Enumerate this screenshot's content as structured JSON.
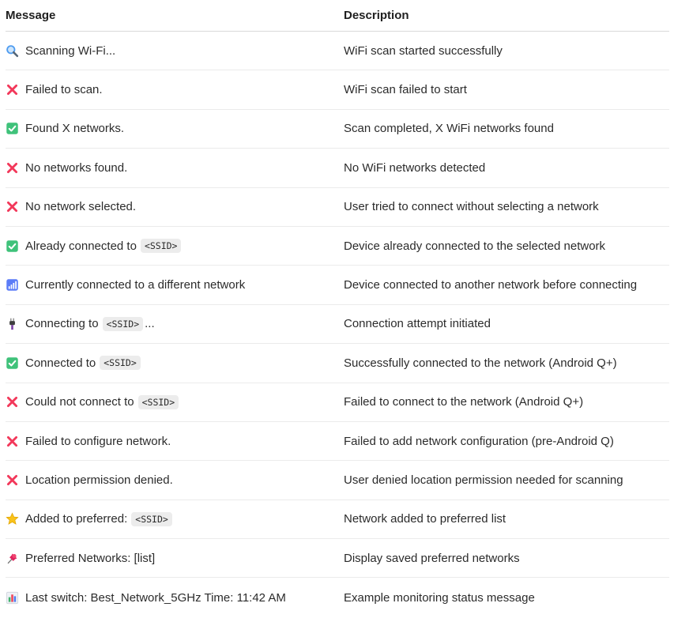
{
  "table": {
    "headers": {
      "message": "Message",
      "description": "Description"
    },
    "rows": [
      {
        "icon": "magnifier-icon",
        "message": "Scanning Wi-Fi...",
        "code": "",
        "suffix": "",
        "description": "WiFi scan started successfully"
      },
      {
        "icon": "cross-mark-icon",
        "message": "Failed to scan.",
        "code": "",
        "suffix": "",
        "description": "WiFi scan failed to start"
      },
      {
        "icon": "check-mark-icon",
        "message": "Found X networks.",
        "code": "",
        "suffix": "",
        "description": "Scan completed, X WiFi networks found"
      },
      {
        "icon": "cross-mark-icon",
        "message": "No networks found.",
        "code": "",
        "suffix": "",
        "description": "No WiFi networks detected"
      },
      {
        "icon": "cross-mark-icon",
        "message": "No network selected.",
        "code": "",
        "suffix": "",
        "description": "User tried to connect without selecting a network"
      },
      {
        "icon": "check-mark-icon",
        "message": "Already connected to",
        "code": "<SSID>",
        "suffix": "",
        "description": "Device already connected to the selected network"
      },
      {
        "icon": "signal-bars-icon",
        "message": "Currently connected to a different network",
        "code": "",
        "suffix": "",
        "description": "Device connected to another network before connecting"
      },
      {
        "icon": "plug-icon",
        "message": "Connecting to",
        "code": "<SSID>",
        "suffix": "...",
        "description": "Connection attempt initiated"
      },
      {
        "icon": "check-mark-icon",
        "message": "Connected to",
        "code": "<SSID>",
        "suffix": "",
        "description": "Successfully connected to the network (Android Q+)"
      },
      {
        "icon": "cross-mark-icon",
        "message": "Could not connect to",
        "code": "<SSID>",
        "suffix": "",
        "description": "Failed to connect to the network (Android Q+)"
      },
      {
        "icon": "cross-mark-icon",
        "message": "Failed to configure network.",
        "code": "",
        "suffix": "",
        "description": "Failed to add network configuration (pre-Android Q)"
      },
      {
        "icon": "cross-mark-icon",
        "message": "Location permission denied.",
        "code": "",
        "suffix": "",
        "description": "User denied location permission needed for scanning"
      },
      {
        "icon": "star-icon",
        "message": "Added to preferred:",
        "code": "<SSID>",
        "suffix": "",
        "description": "Network added to preferred list"
      },
      {
        "icon": "pushpin-icon",
        "message": "Preferred Networks: [list]",
        "code": "",
        "suffix": "",
        "description": "Display saved preferred networks"
      },
      {
        "icon": "bar-chart-icon",
        "message": "Last switch: Best_Network_5GHz Time: 11:42 AM",
        "code": "",
        "suffix": "",
        "description": "Example monitoring status message"
      }
    ]
  },
  "colors": {
    "cross": "#f2385a",
    "check_bg": "#3fc27a",
    "star": "#f9c21a",
    "signal_bg": "#5b7cf7",
    "pin": "#e0245e",
    "magnifier": "#4f9cf0"
  }
}
